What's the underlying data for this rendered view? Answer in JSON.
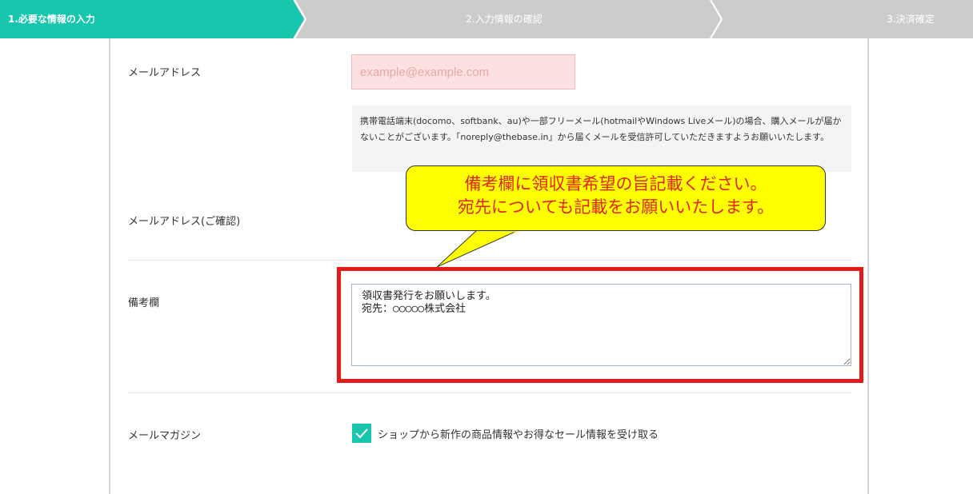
{
  "steps": [
    {
      "label": "1.必要な情報の入力",
      "active": true
    },
    {
      "label": "2.入力情報の確認",
      "active": false
    },
    {
      "label": "3.決済確定",
      "active": false
    }
  ],
  "colors": {
    "accent": "#17c6ad",
    "inactive_step": "#cccccc",
    "highlight_frame": "#e41b1b",
    "callout_bg": "#ffff00",
    "callout_text": "#e0251b"
  },
  "email": {
    "label": "メールアドレス",
    "placeholder": "example@example.com",
    "notice": "携帯電話端末(docomo、softbank、au)や一部フリーメール(hotmailやWindows Liveメール)の場合、購入メールが届かないことがございます。「noreply@thebase.in」から届くメールを受信許可していただきますようお願いいたします。"
  },
  "email_confirm": {
    "label": "メールアドレス(ご確認)"
  },
  "callout": {
    "line1": "備考欄に領収書希望の旨記載ください。",
    "line2": "宛先についても記載をお願いいたします。"
  },
  "remarks": {
    "label": "備考欄",
    "value": "領収書発行をお願いします。\n宛先：○○○○○株式会社"
  },
  "newsletter": {
    "label": "メールマガジン",
    "checked": true,
    "checkbox_label": "ショップから新作の商品情報やお得なセール情報を受け取る"
  }
}
